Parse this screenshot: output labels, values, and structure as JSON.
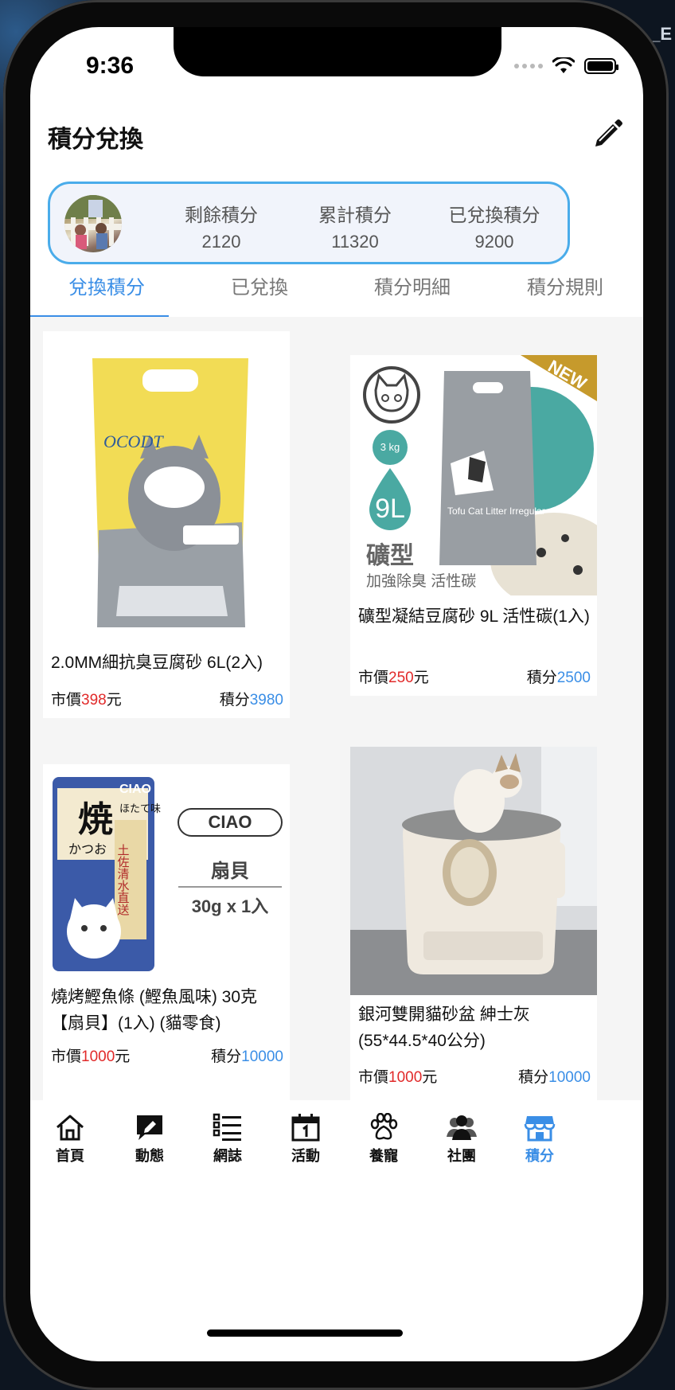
{
  "status_bar": {
    "time": "9:36"
  },
  "corner_text": "_E",
  "header": {
    "title": "積分兌換"
  },
  "points_summary": {
    "remaining": {
      "label": "剩餘積分",
      "value": "2120"
    },
    "accumulated": {
      "label": "累計積分",
      "value": "11320"
    },
    "redeemed": {
      "label": "已兌換積分",
      "value": "9200"
    }
  },
  "tabs": [
    {
      "label": "兌換積分",
      "active": true
    },
    {
      "label": "已兌換",
      "active": false
    },
    {
      "label": "積分明細",
      "active": false
    },
    {
      "label": "積分規則",
      "active": false
    }
  ],
  "products": [
    {
      "name": "2.0MM細抗臭豆腐砂 6L(2入)",
      "market_prefix": "市價",
      "market_price": "398",
      "market_suffix": "元",
      "points_prefix": "積分",
      "points": "3980",
      "image_text": {
        "brand": "OCODT"
      }
    },
    {
      "name": "礦型凝結豆腐砂 9L 活性碳(1入)",
      "market_prefix": "市價",
      "market_price": "250",
      "market_suffix": "元",
      "points_prefix": "積分",
      "points": "2500",
      "image_text": {
        "badge": "NEW",
        "weight": "3 kg",
        "volume": "9L",
        "type": "礦型",
        "feature": "加強除臭 活性碳",
        "pack": "Tofu Cat Litter Irregular"
      }
    },
    {
      "name": "燒烤鰹魚條 (鰹魚風味) 30克【扇貝】(1入) (貓零食)",
      "market_prefix": "市價",
      "market_price": "1000",
      "market_suffix": "元",
      "points_prefix": "積分",
      "points": "10000",
      "image_text": {
        "brand": "CIAO",
        "flavor": "扇貝",
        "spec": "30g x 1入",
        "pack_title": "焼",
        "pack_sub": "かつお",
        "pack_tag": "ほたて味",
        "pack_side": "土佐清水直送"
      }
    },
    {
      "name": "銀河雙開貓砂盆 紳士灰(55*44.5*40公分)",
      "market_prefix": "市價",
      "market_price": "1000",
      "market_suffix": "元",
      "points_prefix": "積分",
      "points": "10000"
    }
  ],
  "bottom_nav": [
    {
      "label": "首頁",
      "icon": "home-icon",
      "active": false
    },
    {
      "label": "動態",
      "icon": "post-icon",
      "active": false
    },
    {
      "label": "網誌",
      "icon": "list-icon",
      "active": false
    },
    {
      "label": "活動",
      "icon": "calendar-icon",
      "active": false
    },
    {
      "label": "養寵",
      "icon": "paw-icon",
      "active": false
    },
    {
      "label": "社團",
      "icon": "group-icon",
      "active": false
    },
    {
      "label": "積分",
      "icon": "store-icon",
      "active": true
    }
  ],
  "colors": {
    "accent": "#3a8ee6",
    "card_border": "#4aacea",
    "price_red": "#e12a2a"
  }
}
